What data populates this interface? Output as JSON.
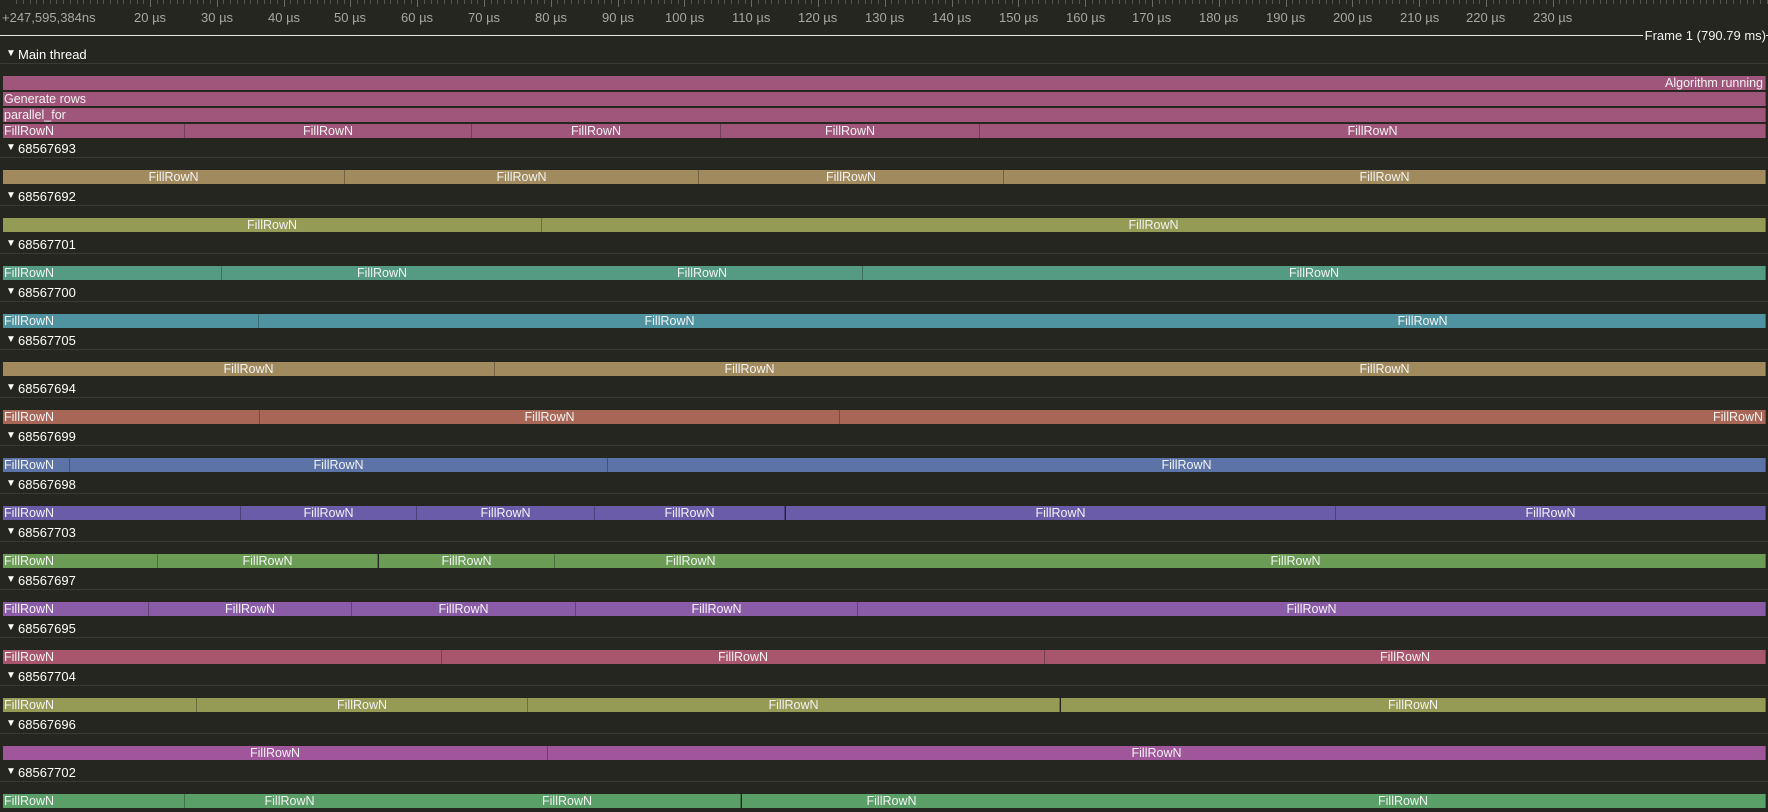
{
  "ruler": {
    "origin_label": "+247,595,384ns",
    "tick_labels": [
      "20 µs",
      "30 µs",
      "40 µs",
      "50 µs",
      "60 µs",
      "70 µs",
      "80 µs",
      "90 µs",
      "100 µs",
      "110 µs",
      "120 µs",
      "130 µs",
      "140 µs",
      "150 µs",
      "160 µs",
      "170 µs",
      "180 µs",
      "190 µs",
      "200 µs",
      "210 µs",
      "220 µs",
      "230 µs"
    ],
    "frame_label": "Frame 1 (790.79 ms)"
  },
  "main_thread": {
    "name": "Main thread",
    "color": "#a0567a",
    "lanes": [
      [
        {
          "label": "Algorithm running",
          "start": 0,
          "end": 1,
          "align": "right"
        }
      ],
      [
        {
          "label": "Generate rows",
          "start": 0,
          "end": 1,
          "align": "left"
        }
      ],
      [
        {
          "label": "parallel_for",
          "start": 0,
          "end": 1,
          "align": "left"
        }
      ],
      [
        {
          "label": "FillRowN",
          "start": 0,
          "end": 0.103,
          "align": "left"
        },
        {
          "label": "FillRowN",
          "start": 0.103,
          "end": 0.266
        },
        {
          "label": "FillRowN",
          "start": 0.266,
          "end": 0.407
        },
        {
          "label": "FillRowN",
          "start": 0.407,
          "end": 0.554
        },
        {
          "label": "FillRowN",
          "start": 0.554,
          "end": 1
        }
      ]
    ]
  },
  "threads": [
    {
      "name": "68567693",
      "color": "#a08a5e",
      "zones": [
        {
          "label": "FillRowN",
          "start": 0,
          "end": 0.194
        },
        {
          "label": "FillRowN",
          "start": 0.194,
          "end": 0.395
        },
        {
          "label": "FillRowN",
          "start": 0.395,
          "end": 0.568
        },
        {
          "label": "FillRowN",
          "start": 0.568,
          "end": 1
        }
      ]
    },
    {
      "name": "68567692",
      "color": "#949b54",
      "zones": [
        {
          "label": "FillRowN",
          "start": 0,
          "end": 0.306
        },
        {
          "label": "FillRowN",
          "start": 0.306,
          "end": 1
        }
      ]
    },
    {
      "name": "68567701",
      "color": "#559a82",
      "zones": [
        {
          "label": "FillRowN",
          "start": 0,
          "end": 0.124,
          "align": "left"
        },
        {
          "label": "FillRowN",
          "start": 0.124,
          "end": 0.306
        },
        {
          "label": "FillRowN",
          "start": 0.306,
          "end": 0.488
        },
        {
          "label": "FillRowN",
          "start": 0.488,
          "end": 1
        }
      ]
    },
    {
      "name": "68567700",
      "color": "#4f93a0",
      "zones": [
        {
          "label": "FillRowN",
          "start": 0,
          "end": 0.145,
          "align": "left"
        },
        {
          "label": "FillRowN",
          "start": 0.145,
          "end": 0.611
        },
        {
          "label": "FillRowN",
          "start": 0.611,
          "end": 1
        }
      ]
    },
    {
      "name": "68567705",
      "color": "#a08a5e",
      "zones": [
        {
          "label": "FillRowN",
          "start": 0,
          "end": 0.279
        },
        {
          "label": "FillRowN",
          "start": 0.279,
          "end": 0.568
        },
        {
          "label": "FillRowN",
          "start": 0.568,
          "end": 1
        }
      ]
    },
    {
      "name": "68567694",
      "color": "#a86657",
      "zones": [
        {
          "label": "FillRowN",
          "start": 0,
          "end": 0.146,
          "align": "left"
        },
        {
          "label": "FillRowN",
          "start": 0.146,
          "end": 0.475
        },
        {
          "label": "FillRowN",
          "start": 0.475,
          "end": 1,
          "align": "right"
        }
      ]
    },
    {
      "name": "68567699",
      "color": "#5b73a6",
      "zones": [
        {
          "label": "FillRowN",
          "start": 0,
          "end": 0.038,
          "align": "left"
        },
        {
          "label": "FillRowN",
          "start": 0.038,
          "end": 0.343
        },
        {
          "label": "FillRowN",
          "start": 0.343,
          "end": 1
        }
      ]
    },
    {
      "name": "68567698",
      "color": "#6a5ca8",
      "zones": [
        {
          "label": "FillRowN",
          "start": 0,
          "end": 0.135,
          "align": "left"
        },
        {
          "label": "FillRowN",
          "start": 0.135,
          "end": 0.235
        },
        {
          "label": "FillRowN",
          "start": 0.235,
          "end": 0.336
        },
        {
          "label": "FillRowN",
          "start": 0.336,
          "end": 0.444
        },
        {
          "label": "FillRowN",
          "start": 0.444,
          "end": 0.756
        },
        {
          "label": "FillRowN",
          "start": 0.756,
          "end": 1
        }
      ]
    },
    {
      "name": "68567703",
      "color": "#6a9c55",
      "zones": [
        {
          "label": "FillRowN",
          "start": 0,
          "end": 0.088,
          "align": "left"
        },
        {
          "label": "FillRowN",
          "start": 0.088,
          "end": 0.213
        },
        {
          "label": "FillRowN",
          "start": 0.213,
          "end": 0.313
        },
        {
          "label": "FillRowN",
          "start": 0.313,
          "end": 0.467
        },
        {
          "label": "FillRowN",
          "start": 0.467,
          "end": 1
        }
      ]
    },
    {
      "name": "68567697",
      "color": "#8a5ca8",
      "zones": [
        {
          "label": "FillRowN",
          "start": 0,
          "end": 0.083,
          "align": "left"
        },
        {
          "label": "FillRowN",
          "start": 0.083,
          "end": 0.198
        },
        {
          "label": "FillRowN",
          "start": 0.198,
          "end": 0.325
        },
        {
          "label": "FillRowN",
          "start": 0.325,
          "end": 0.485
        },
        {
          "label": "FillRowN",
          "start": 0.485,
          "end": 1
        }
      ]
    },
    {
      "name": "68567695",
      "color": "#a8566e",
      "zones": [
        {
          "label": "FillRowN",
          "start": 0,
          "end": 0.249,
          "align": "left"
        },
        {
          "label": "FillRowN",
          "start": 0.249,
          "end": 0.591
        },
        {
          "label": "FillRowN",
          "start": 0.591,
          "end": 1
        }
      ]
    },
    {
      "name": "68567704",
      "color": "#959a55",
      "zones": [
        {
          "label": "FillRowN",
          "start": 0,
          "end": 0.11,
          "align": "left"
        },
        {
          "label": "FillRowN",
          "start": 0.11,
          "end": 0.298
        },
        {
          "label": "FillRowN",
          "start": 0.298,
          "end": 0.6
        },
        {
          "label": "FillRowN",
          "start": 0.6,
          "end": 1
        }
      ]
    },
    {
      "name": "68567696",
      "color": "#a0569a",
      "zones": [
        {
          "label": "FillRowN",
          "start": 0,
          "end": 0.309
        },
        {
          "label": "FillRowN",
          "start": 0.309,
          "end": 1
        }
      ]
    },
    {
      "name": "68567702",
      "color": "#5a9e68",
      "zones": [
        {
          "label": "FillRowN",
          "start": 0,
          "end": 0.103,
          "align": "left"
        },
        {
          "label": "FillRowN",
          "start": 0.103,
          "end": 0.222
        },
        {
          "label": "FillRowN",
          "start": 0.222,
          "end": 0.419
        },
        {
          "label": "FillRowN",
          "start": 0.419,
          "end": 0.589
        },
        {
          "label": "FillRowN",
          "start": 0.589,
          "end": 1
        }
      ]
    }
  ]
}
